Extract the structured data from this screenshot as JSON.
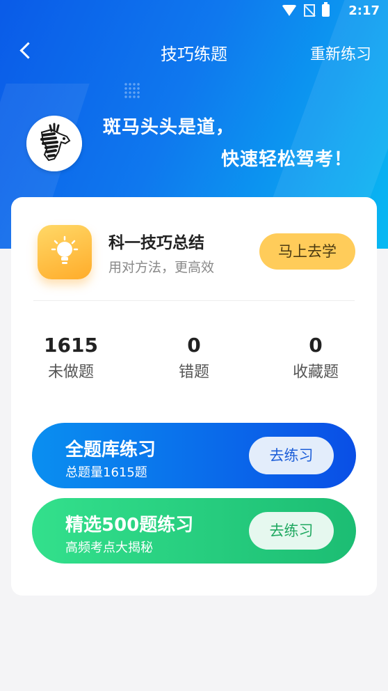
{
  "status_bar": {
    "time": "2:17",
    "icons": [
      "wifi-icon",
      "no-sim-icon",
      "battery-icon"
    ]
  },
  "header": {
    "title": "技巧练题",
    "reset_label": "重新练习",
    "back_icon": "chevron-left-icon"
  },
  "hero": {
    "slogan_line1": "斑马头头是道，",
    "slogan_line2": "快速轻松驾考！",
    "avatar_icon": "zebra-logo-icon"
  },
  "tips": {
    "title": "科一技巧总结",
    "subtitle": "用对方法，更高效",
    "button_label": "马上去学",
    "icon": "lightbulb-icon"
  },
  "stats": [
    {
      "value": "1615",
      "label": "未做题"
    },
    {
      "value": "0",
      "label": "错题"
    },
    {
      "value": "0",
      "label": "收藏题"
    }
  ],
  "practice": [
    {
      "title": "全题库练习",
      "subtitle": "总题量1615题",
      "button_label": "去练习"
    },
    {
      "title": "精选500题练习",
      "subtitle": "高频考点大揭秘",
      "button_label": "去练习"
    }
  ],
  "colors": {
    "header_blue": "#0a5be8",
    "accent_yellow": "#ffcc5a",
    "practice_blue": "#0a4fe6",
    "practice_green": "#1cbd73"
  }
}
